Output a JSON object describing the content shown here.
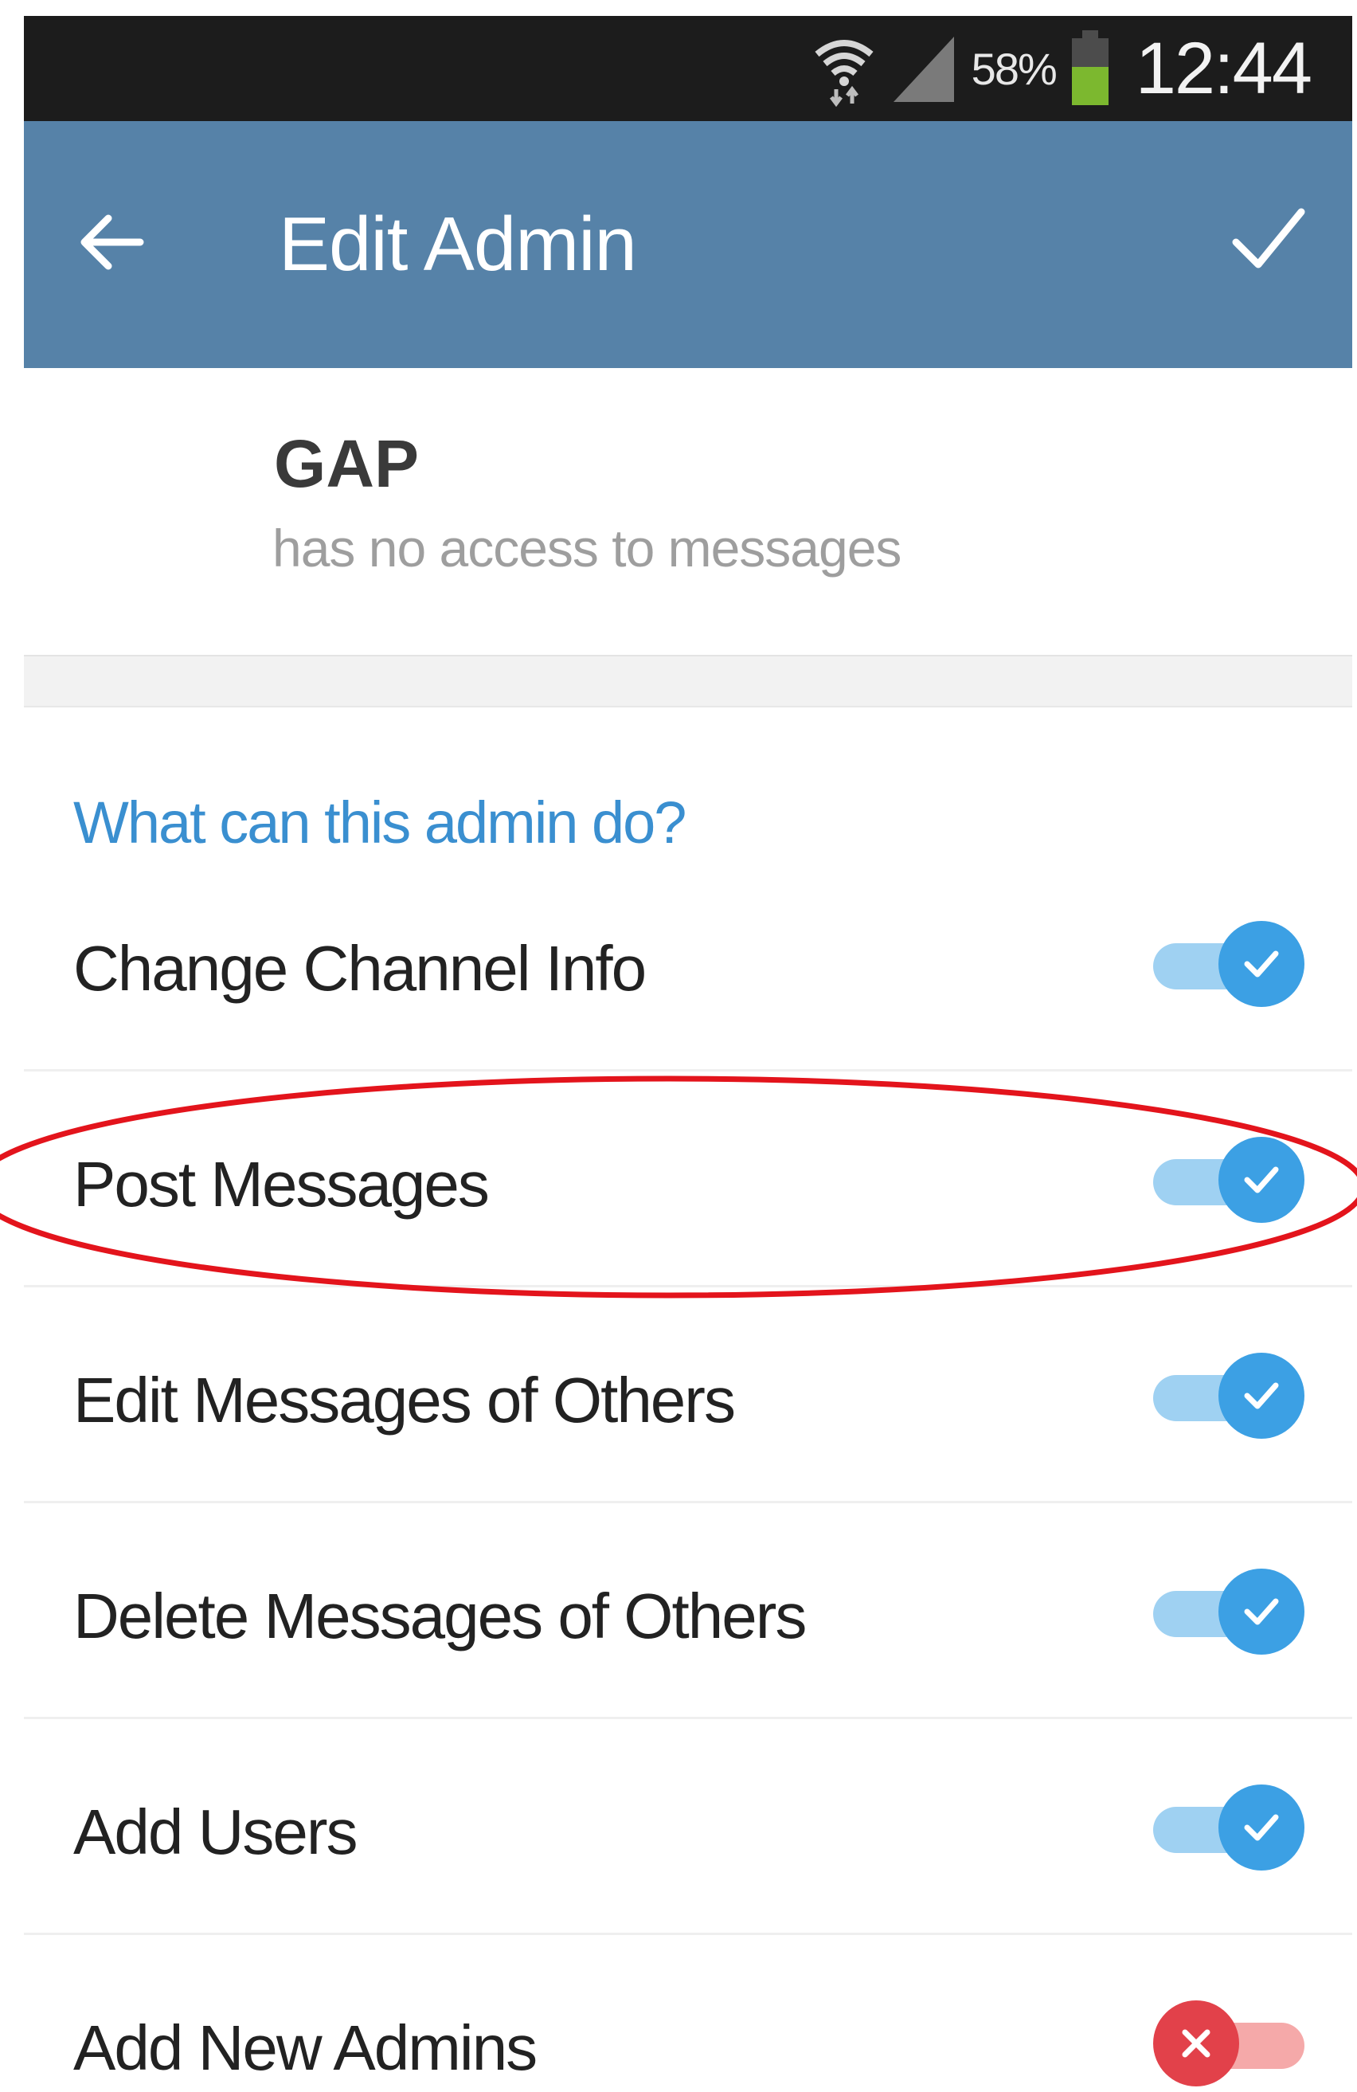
{
  "status_bar": {
    "battery_percent": "58%",
    "time": "12:44",
    "icons": [
      "wifi-icon",
      "signal-icon",
      "battery-icon"
    ]
  },
  "action_bar": {
    "back_icon": "arrow-left-icon",
    "title": "Edit Admin",
    "confirm_icon": "checkmark-icon"
  },
  "user": {
    "name": "GAP",
    "status": "has no access to messages"
  },
  "section": {
    "header": "What can this admin do?"
  },
  "permissions": [
    {
      "label": "Change Channel Info",
      "enabled": true
    },
    {
      "label": "Post Messages",
      "enabled": true
    },
    {
      "label": "Edit Messages of Others",
      "enabled": true
    },
    {
      "label": "Delete Messages of Others",
      "enabled": true
    },
    {
      "label": "Add Users",
      "enabled": true
    },
    {
      "label": "Add New Admins",
      "enabled": false
    }
  ],
  "colors": {
    "action_bar": "#5682a8",
    "accent": "#3ca0e4",
    "toggle_off": "#e2414a",
    "highlight": "#e3141c"
  }
}
